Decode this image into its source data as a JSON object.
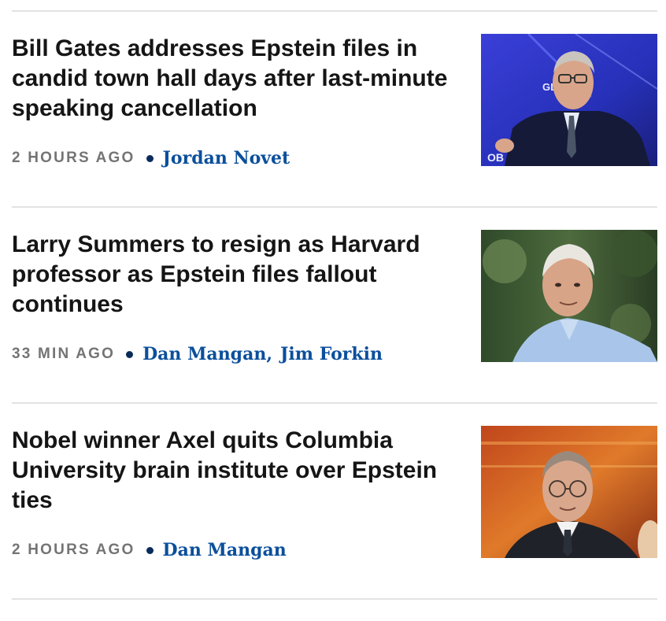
{
  "stories": [
    {
      "headline": "Bill Gates addresses Epstein files in candid town hall days after last-minute speaking cancellation",
      "time": "2 HOURS AGO",
      "authors": [
        "Jordan Novet"
      ]
    },
    {
      "headline": "Larry Summers to resign as Harvard professor as Epstein files fallout continues",
      "time": "33 MIN AGO",
      "authors": [
        "Dan Mangan",
        "Jim Forkin"
      ]
    },
    {
      "headline": "Nobel winner Axel quits Columbia University brain institute over Epstein ties",
      "time": "2 HOURS AGO",
      "authors": [
        "Dan Mangan"
      ]
    }
  ],
  "colors": {
    "headline": "#151515",
    "timestamp": "#747474",
    "author_link": "#0b4f9c",
    "bullet": "#0a2b5a",
    "divider": "#e3e3e3"
  }
}
